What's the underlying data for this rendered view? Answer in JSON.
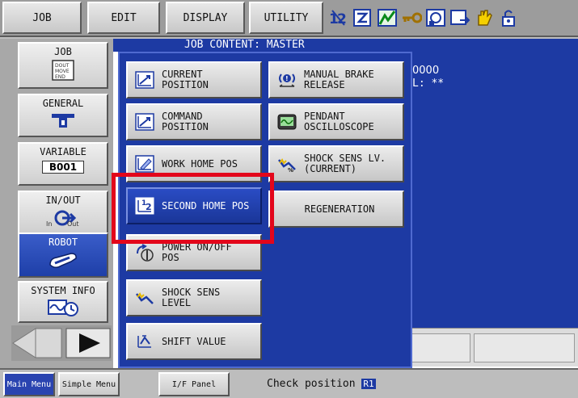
{
  "topbar": {
    "job": "JOB",
    "edit": "EDIT",
    "display": "DISPLAY",
    "utility": "UTILITY",
    "icons": [
      "mode-12-icon",
      "teach-icon",
      "chart-icon",
      "key-icon",
      "io-icon",
      "screen-arrow-icon",
      "hand-icon",
      "security-icon"
    ]
  },
  "leftmenu": {
    "job": "JOB",
    "job_icon_lines": [
      "DOUT",
      "MOVE",
      "END"
    ],
    "general": "GENERAL",
    "variable": "VARIABLE",
    "variable_value": "B001",
    "inout": "IN/OUT",
    "inout_in": "In",
    "inout_out": "Out",
    "robot": "ROBOT",
    "system_info": "SYSTEM INFO"
  },
  "jobwin": {
    "title": "JOB CONTENT: MASTER",
    "line1": "0000",
    "line2": "L: **"
  },
  "submenu": {
    "current_position": "CURRENT\nPOSITION",
    "command_position": "COMMAND\nPOSITION",
    "work_home_pos": "WORK HOME POS",
    "second_home_pos": "SECOND HOME POS",
    "power_onoff_pos": "POWER ON/OFF\nPOS",
    "shock_sens_level": "SHOCK SENS\nLEVEL",
    "shift_value": "SHIFT VALUE",
    "manual_brake_release": "MANUAL BRAKE\nRELEASE",
    "pendant_oscilloscope": "PENDANT\nOSCILLOSCOPE",
    "shock_sens_lv_current": "SHOCK SENS LV.\n(CURRENT)",
    "regeneration": "REGENERATION"
  },
  "bottombar": {
    "main_menu": "Main Menu",
    "simple_menu": "Simple Menu",
    "if_panel": "I/F Panel",
    "status": "Check position",
    "status_badge": "R1"
  }
}
